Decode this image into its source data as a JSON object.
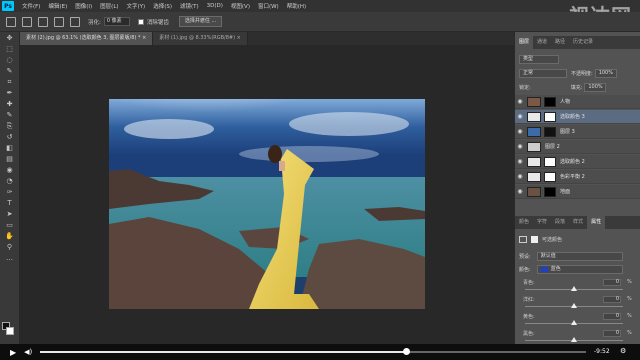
{
  "app": {
    "logo": "Ps",
    "watermark": "视达网"
  },
  "menu": [
    "文件(F)",
    "编辑(E)",
    "图像(I)",
    "图层(L)",
    "文字(Y)",
    "选择(S)",
    "滤镜(T)",
    "3D(D)",
    "视图(V)",
    "窗口(W)",
    "帮助(H)"
  ],
  "options": {
    "feather_label": "羽化:",
    "feather_value": "0 像素",
    "antialias_label": "消除锯齿",
    "select_mask_button": "选择并遮住 ..."
  },
  "doc_tabs": [
    {
      "label": "素材 (2).jpg @ 63.1% (选取颜色 3, 图层蒙版/8) *",
      "close": "×"
    },
    {
      "label": "素材 (1).jpg @ 8.33%(RGB/8#)",
      "close": "×"
    }
  ],
  "tools": [
    "move-icon",
    "marquee-icon",
    "lasso-icon",
    "quick-select-icon",
    "crop-icon",
    "eyedropper-icon",
    "healing-icon",
    "brush-icon",
    "stamp-icon",
    "history-brush-icon",
    "eraser-icon",
    "gradient-icon",
    "blur-icon",
    "dodge-icon",
    "pen-icon",
    "type-icon",
    "path-select-icon",
    "shape-icon",
    "hand-icon",
    "zoom-icon",
    "more-icon"
  ],
  "tool_glyphs": [
    "✥",
    "⬚",
    "◌",
    "✎",
    "⌗",
    "✒",
    "✚",
    "✎",
    "⎘",
    "↺",
    "◧",
    "▤",
    "◉",
    "◔",
    "✑",
    "T",
    "➤",
    "▭",
    "✋",
    "⚲",
    "…"
  ],
  "layers_panel": {
    "tabs": [
      "图层",
      "通道",
      "路径",
      "历史记录"
    ],
    "filter_type": "类型",
    "blend_mode": "正常",
    "opacity_label": "不透明度:",
    "opacity_value": "100%",
    "lock_label": "锁定:",
    "fill_label": "填充:",
    "fill_value": "100%",
    "layers": [
      {
        "name": "人物",
        "selected": false
      },
      {
        "name": "选取颜色 3",
        "selected": true
      },
      {
        "name": "图层 3",
        "selected": false
      },
      {
        "name": "图层 2",
        "selected": false
      },
      {
        "name": "选取颜色 2",
        "selected": false
      },
      {
        "name": "色彩平衡 2",
        "selected": false
      },
      {
        "name": "地面",
        "selected": false
      }
    ]
  },
  "properties_panel": {
    "tabs": [
      "颜色",
      "字符",
      "段落",
      "样式",
      "属性"
    ],
    "title": "可选颜色",
    "preset_label": "预设:",
    "preset_value": "默认值",
    "colors_label": "颜色:",
    "colors_value": "蓝色",
    "sliders": [
      {
        "label": "青色:",
        "value": "0",
        "level": 0
      },
      {
        "label": "洋红:",
        "value": "0",
        "level": 0
      },
      {
        "label": "黄色:",
        "value": "0",
        "level": 0
      },
      {
        "label": "黑色:",
        "value": "0",
        "level": 0
      }
    ],
    "percent": "%"
  },
  "video": {
    "time": "-9:52",
    "progress": 0.67
  },
  "colors": {
    "accent": "#00c8ff",
    "selection": "#5a6b82",
    "dropdown_blue": "#1f3fc4"
  }
}
